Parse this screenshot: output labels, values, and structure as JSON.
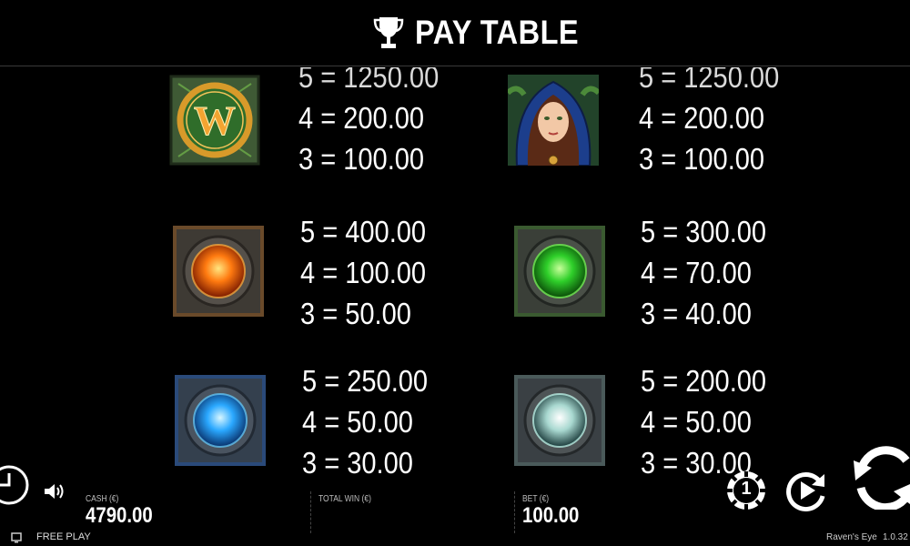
{
  "header": {
    "title": "PAY TABLE",
    "icon": "trophy-icon"
  },
  "paytable": [
    {
      "symbol": "wild-w",
      "pays": [
        "5 = 1250.00",
        "4 = 200.00",
        "3 = 100.00"
      ]
    },
    {
      "symbol": "hooded-woman",
      "pays": [
        "5 = 1250.00",
        "4 = 200.00",
        "3 = 100.00"
      ]
    },
    {
      "symbol": "fire-orb",
      "pays": [
        "5 = 400.00",
        "4 = 100.00",
        "3 = 50.00"
      ]
    },
    {
      "symbol": "green-orb",
      "pays": [
        "5 = 300.00",
        "4 = 70.00",
        "3 = 40.00"
      ]
    },
    {
      "symbol": "blue-orb",
      "pays": [
        "5 = 250.00",
        "4 = 50.00",
        "3 = 30.00"
      ]
    },
    {
      "symbol": "white-orb",
      "pays": [
        "5 = 200.00",
        "4 = 50.00",
        "3 = 30.00"
      ]
    }
  ],
  "footer": {
    "cash_label": "CASH (€)",
    "cash_value": "4790.00",
    "total_win_label": "TOTAL WIN (€)",
    "bet_label": "BET (€)",
    "bet_value": "100.00",
    "chip_value": "1",
    "free_play": "FREE PLAY",
    "game_name": "Raven's Eye",
    "version": "1.0.32"
  }
}
